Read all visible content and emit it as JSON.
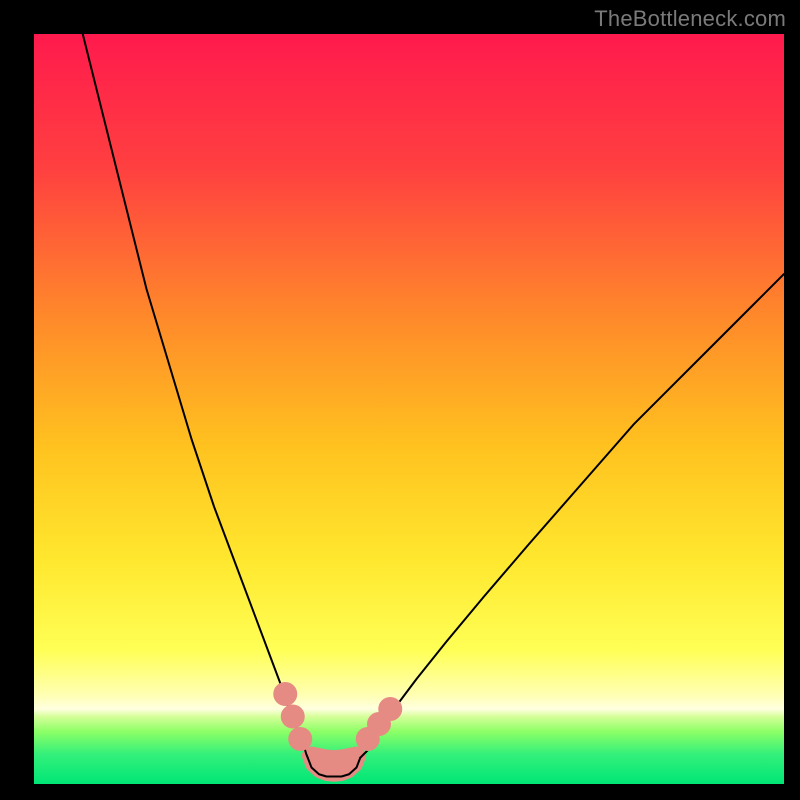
{
  "watermark": {
    "text": "TheBottleneck.com"
  },
  "chart_data": {
    "type": "line",
    "title": "",
    "xlabel": "",
    "ylabel": "",
    "xlim": [
      0,
      100
    ],
    "ylim": [
      0,
      100
    ],
    "grid": false,
    "legend": false,
    "background_gradient": {
      "top": "#ff1a4d",
      "mid_upper": "#ff8a2a",
      "mid": "#ffd400",
      "mid_lower": "#ffff55",
      "band_light": "#ffffb0",
      "green_top": "#7fff55",
      "green_bottom": "#00e676"
    },
    "series": [
      {
        "name": "left-arm",
        "stroke": "#000000",
        "x": [
          6.5,
          9,
          12,
          15,
          18,
          21,
          24,
          27,
          30,
          31.5,
          33,
          34,
          34.8,
          35.5,
          36,
          36.3,
          36.5
        ],
        "values": [
          100,
          90,
          78,
          66,
          56,
          46,
          37,
          29,
          21,
          17,
          13,
          10,
          8,
          6,
          5,
          4,
          3.5
        ]
      },
      {
        "name": "right-arm",
        "stroke": "#000000",
        "x": [
          43.5,
          44,
          45,
          46,
          48,
          51,
          55,
          60,
          66,
          73,
          80,
          88,
          96,
          100
        ],
        "values": [
          3.5,
          4,
          5,
          7,
          10,
          14,
          19,
          25,
          32,
          40,
          48,
          56,
          64,
          68
        ]
      },
      {
        "name": "valley-floor",
        "stroke": "#000000",
        "x": [
          36.5,
          37,
          38,
          39,
          40,
          41,
          42,
          43,
          43.5
        ],
        "values": [
          3.5,
          2.2,
          1.3,
          1.0,
          1.0,
          1.0,
          1.3,
          2.2,
          3.5
        ]
      }
    ],
    "markers": [
      {
        "name": "left-dot-1",
        "x": 33.5,
        "y": 12,
        "r": 1.6,
        "fill": "#e58b84"
      },
      {
        "name": "left-dot-2",
        "x": 34.5,
        "y": 9,
        "r": 1.6,
        "fill": "#e58b84"
      },
      {
        "name": "left-dot-3",
        "x": 35.5,
        "y": 6,
        "r": 1.6,
        "fill": "#e58b84"
      },
      {
        "name": "right-dot-1",
        "x": 44.5,
        "y": 6,
        "r": 1.6,
        "fill": "#e58b84"
      },
      {
        "name": "right-dot-2",
        "x": 46.0,
        "y": 8,
        "r": 1.6,
        "fill": "#e58b84"
      },
      {
        "name": "right-dot-3",
        "x": 47.5,
        "y": 10,
        "r": 1.6,
        "fill": "#e58b84"
      }
    ],
    "valley_blob": {
      "fill": "#e58b84",
      "points_xy": [
        [
          36.5,
          3.8
        ],
        [
          37.0,
          2.5
        ],
        [
          38.0,
          1.6
        ],
        [
          39.0,
          1.2
        ],
        [
          40.0,
          1.1
        ],
        [
          41.0,
          1.2
        ],
        [
          42.0,
          1.6
        ],
        [
          43.0,
          2.5
        ],
        [
          43.5,
          3.8
        ],
        [
          43.0,
          4.2
        ],
        [
          42.0,
          4.0
        ],
        [
          41.0,
          3.8
        ],
        [
          40.0,
          3.7
        ],
        [
          39.0,
          3.8
        ],
        [
          38.0,
          4.0
        ],
        [
          37.0,
          4.2
        ]
      ]
    }
  }
}
